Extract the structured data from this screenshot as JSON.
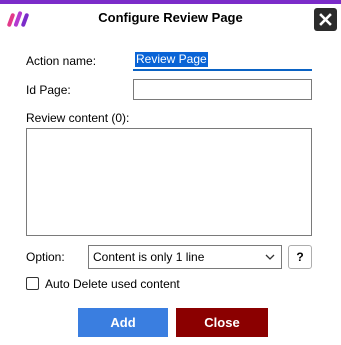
{
  "window": {
    "title": "Configure Review Page",
    "accent_color": "#7b2cc9"
  },
  "form": {
    "action_name_label": "Action name:",
    "action_name_value": "Review Page",
    "id_page_label": "Id Page:",
    "id_page_value": "",
    "review_content_label": "Review content (0):",
    "review_content_value": "",
    "option_label": "Option:",
    "option_selected": "Content is only 1 line",
    "help_label": "?",
    "auto_delete_label": "Auto Delete used content",
    "auto_delete_checked": false
  },
  "buttons": {
    "add_label": "Add",
    "add_color": "#3a7ee0",
    "close_label": "Close",
    "close_color": "#8b0000"
  },
  "icons": {
    "app": "app-logo-icon",
    "close": "close-icon",
    "dropdown": "chevron-down-icon"
  }
}
